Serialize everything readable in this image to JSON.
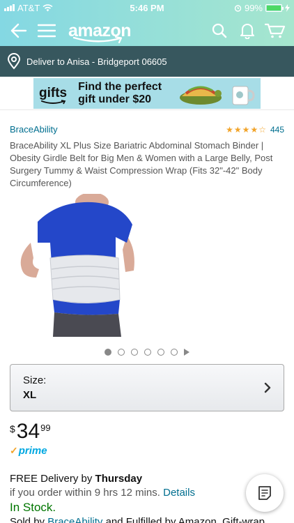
{
  "status_bar": {
    "carrier": "AT&T",
    "time": "5:46 PM",
    "battery": "99%"
  },
  "header": {
    "logo": "amazon",
    "icons": [
      "back-arrow-icon",
      "menu-icon",
      "search-icon",
      "notification-bell-icon",
      "cart-icon"
    ]
  },
  "delivery_bar": {
    "text": "Deliver to Anisa - Bridgeport 06605"
  },
  "banner": {
    "brand": "gifts",
    "line1": "Find the perfect",
    "line2": "gift under $20"
  },
  "product": {
    "brand": "BraceAbility",
    "rating": 4.5,
    "review_count": "445",
    "title": "BraceAbility XL Plus Size Bariatric Abdominal Stomach Binder | Obesity Girdle Belt for Big Men & Women with a Large Belly, Post Surgery Tummy & Waist Compression Wrap (Fits 32\"-42\" Body Circumference)",
    "image_count": 6,
    "active_image": 1
  },
  "size_selector": {
    "label": "Size:",
    "value": "XL"
  },
  "price": {
    "currency": "$",
    "dollars": "34",
    "cents": "99",
    "prime": "prime"
  },
  "shipping": {
    "free_delivery_prefix": "FREE Delivery by ",
    "free_delivery_day": "Thursday",
    "order_within": "if you order within 9 hrs 12 mins.",
    "details_link": "Details",
    "stock": "In Stock.",
    "sold_by_prefix": "Sold by ",
    "sold_by_link": "BraceAbility",
    "sold_by_suffix": " and Fulfilled by Amazon. Gift-wrap"
  },
  "colors": {
    "header_start": "#84d8e3",
    "header_end": "#a6e6ce",
    "delivery_bar": "#37575e",
    "link": "#006e8f",
    "in_stock": "#007600",
    "prime": "#00a8e1"
  }
}
